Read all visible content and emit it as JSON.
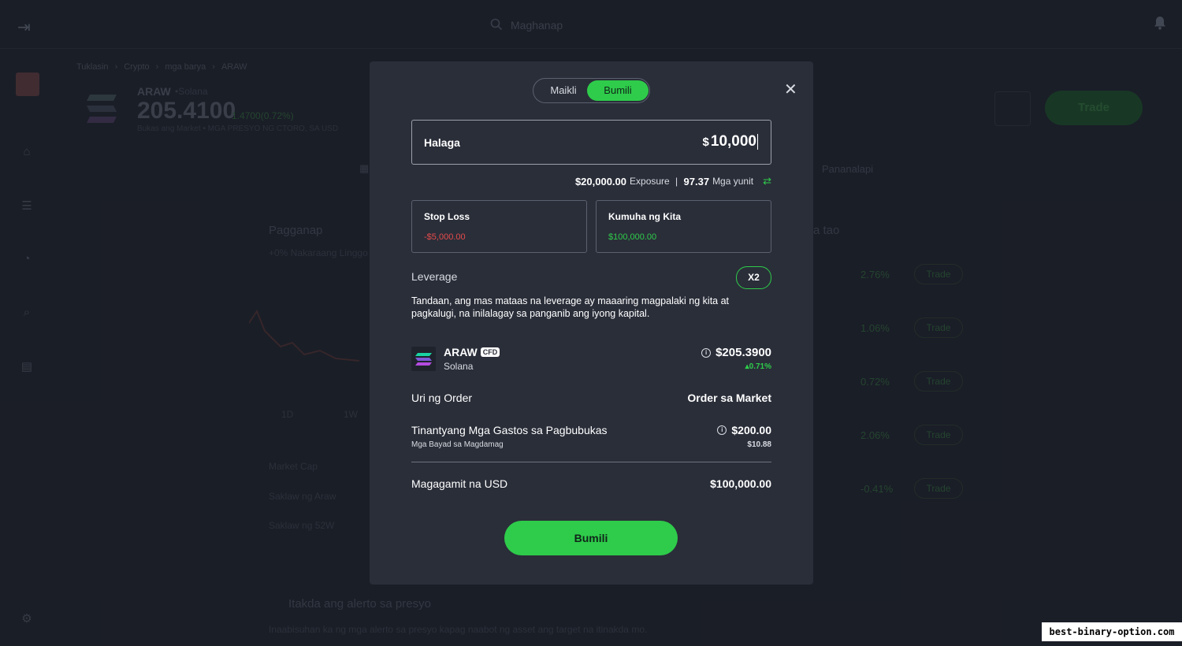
{
  "topbar": {
    "search_placeholder": "Maghanap"
  },
  "breadcrumb": [
    "Tuklasin",
    "Crypto",
    "mga barya",
    "ARAW"
  ],
  "asset": {
    "name": "ARAW",
    "sub": "•Solana",
    "price": "205.4100",
    "change": "1.4700(0.72%)",
    "note": "Bukas ang Market  •  MGA PRESYO NG CTORO, SA USD"
  },
  "background": {
    "trade_button": "Trade",
    "tab_finance": "Pananalapi",
    "panel_title": "Pagganap",
    "panel_sub": "+0%  Nakaraang Linggo",
    "ranges": [
      "1D",
      "1W"
    ],
    "stats": [
      "Market Cap",
      "Saklaw ng Araw",
      "Saklaw ng 52W"
    ],
    "people_title": "a tao",
    "people_pcts": [
      "2.76%",
      "1.06%",
      "0.72%",
      "2.06%",
      "-0.41%"
    ],
    "people_trade": "Trade",
    "alert_title": "Itakda ang alerto sa presyo",
    "alert_sub": "Inaabisuhan ka ng mga alerto sa presyo kapag naabot ng asset ang target na itinakda mo."
  },
  "modal": {
    "tab_short": "Maikli",
    "tab_buy": "Bumili",
    "amount_label": "Halaga",
    "amount_currency": "$",
    "amount_value": "10,000",
    "exposure_value": "$20,000.00",
    "exposure_label": "Exposure",
    "units_value": "97.37",
    "units_label": "Mga yunit",
    "stop_loss_label": "Stop Loss",
    "stop_loss_value": "-$5,000.00",
    "take_profit_label": "Kumuha ng Kita",
    "take_profit_value": "$100,000.00",
    "leverage_label": "Leverage",
    "leverage_value": "X2",
    "leverage_note": "Tandaan, ang mas mataas na leverage ay maaaring magpalaki ng kita at pagkalugi, na inilalagay sa panganib ang iyong kapital.",
    "instrument_name": "ARAW",
    "instrument_badge": "CFD",
    "instrument_sub": "Solana",
    "instrument_price": "$205.3900",
    "instrument_change": "0.71%",
    "order_type_label": "Uri ng Order",
    "order_type_value": "Order sa Market",
    "cost_label": "Tinantyang Mga Gastos sa Pagbubukas",
    "cost_value": "$200.00",
    "cost_sub_label": "Mga Bayad sa Magdamag",
    "cost_sub_value": "$10.88",
    "available_label": "Magagamit na USD",
    "available_value": "$100,000.00",
    "submit_label": "Bumili"
  },
  "watermark": "best-binary-option.com",
  "colors": {
    "accent": "#2ecc4a",
    "loss": "#e54b4b",
    "modal_bg": "#2a2e39",
    "app_bg": "#20242e"
  }
}
